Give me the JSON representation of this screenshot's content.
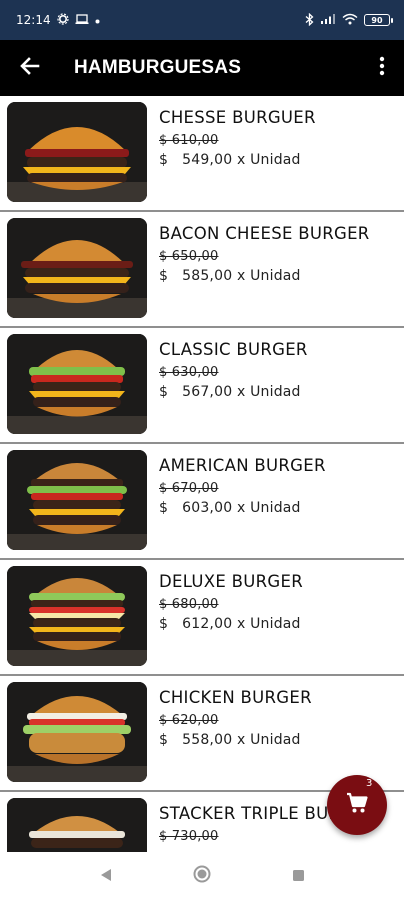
{
  "status_bar": {
    "time": "12:14",
    "left_icons": [
      "gear-icon",
      "laptop-icon",
      "dot-icon"
    ],
    "right_icons": [
      "bluetooth-icon",
      "signal-icon",
      "wifi-icon"
    ],
    "battery": "90"
  },
  "app_bar": {
    "title": "HAMBURGUESAS",
    "back_icon": "arrow-left-icon",
    "menu_icon": "more-vert-icon"
  },
  "products": [
    {
      "name": "CHESSE BURGUER",
      "old_price": "$ 610,00",
      "currency": "$",
      "price": "549,00 x Unidad",
      "image": "cheese-burger-image"
    },
    {
      "name": "BACON CHEESE BURGER",
      "old_price": "$ 650,00",
      "currency": "$",
      "price": "585,00 x Unidad",
      "image": "bacon-burger-image"
    },
    {
      "name": "CLASSIC BURGER",
      "old_price": "$ 630,00",
      "currency": "$",
      "price": "567,00 x Unidad",
      "image": "classic-burger-image"
    },
    {
      "name": "AMERICAN BURGER",
      "old_price": "$ 670,00",
      "currency": "$",
      "price": "603,00 x Unidad",
      "image": "american-burger-image"
    },
    {
      "name": " DELUXE BURGER",
      "old_price": "$ 680,00",
      "currency": "$",
      "price": "612,00 x Unidad",
      "image": "deluxe-burger-image"
    },
    {
      "name": "CHICKEN BURGER",
      "old_price": "$ 620,00",
      "currency": "$",
      "price": "558,00 x Unidad",
      "image": "chicken-burger-image"
    },
    {
      "name": "STACKER TRIPLE BURGER",
      "old_price": "$ 730,00",
      "currency": "$",
      "price": "",
      "image": "stacker-burger-image"
    }
  ],
  "cart": {
    "count": "3",
    "icon": "cart-icon",
    "color": "#7a0d12"
  },
  "nav_bar": {
    "icons": [
      "back-triangle-icon",
      "home-circle-icon",
      "recents-square-icon"
    ]
  },
  "colors": {
    "status_bar": "#1d3352",
    "app_bar": "#000000",
    "divider": "#8f8f8f"
  }
}
